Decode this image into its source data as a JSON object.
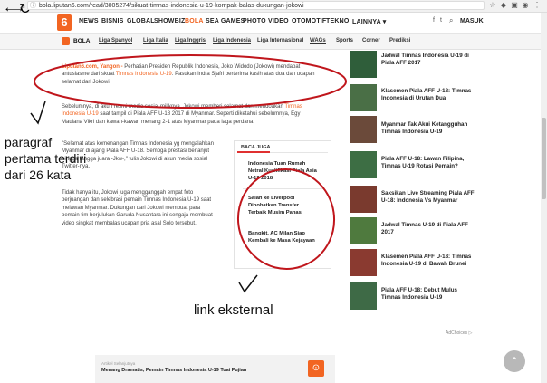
{
  "browser": {
    "url": "bola.liputan6.com/read/3005274/sikuat-timnas-indonesia-u-19-kompak-balas-dukungan-jokowi"
  },
  "header": {
    "logo_text": "6",
    "nav": [
      "NEWS",
      "BISNIS",
      "GLOBAL",
      "SHOWBIZ",
      "BOLA",
      "SEA GAMES",
      "PHOTO",
      "VIDEO",
      "OTOMOTIF",
      "TEKNO",
      "LAINNYA ▾"
    ],
    "active": "BOLA",
    "login": "MASUK"
  },
  "subnav": {
    "section": "BOLA",
    "items": [
      "Liga Spanyol",
      "Liga Italia",
      "Liga Inggris",
      "Liga Indonesia",
      "Liga Internasional",
      "WAGs",
      "Sports",
      "Corner",
      "Prediksi"
    ]
  },
  "article": {
    "p1_source": "Liputan6.com, Yangon -",
    "p1_a": " Perhatian Presiden Republik Indonesia, Joko Widodo (Jokowi) mendapat",
    "p1_b": "antusiasme dari skuat ",
    "p1_link": "Timnas Indonesia U-19",
    "p1_c": ". Pasukan Indra Sjafri berterima kasih atas doa dan ucapan",
    "p1_d": "selamat dari Jokowi.",
    "p2_a": "Sebelumnya, di akun resmi media sosial miliknya, Jokowi memberi selamat dan mendoakan ",
    "p2_link1": "Timnas",
    "p2_b": "Indonesia U-19",
    "p2_c": " saat tampil di Piala AFF U-18 2017 di Myanmar. Seperti diketahui sebelumnya, Egy",
    "p2_d": "Maulana Vikri dan kawan-kawan menang 2-1 atas Myanmar pada laga perdana.",
    "p3_lines": [
      "\"Selamat atas kemenangan Timnas Indonesia yg mengalahkan",
      "Myanmar di ajang Piala AFF U-18. Semoga prestasi berlanjut",
      "hingga tangga juara -Jkw-,\" tulis Jokowi di akun media sosial",
      "Twitter-nya."
    ],
    "p4_lines": [
      "Tidak hanya itu, Jokowi juga mengganggah empat foto",
      "perjuangan dan selebrasi pemain Timnas Indonesia U-19 saat",
      "melawan Myanmar. Dukungan dari Jokowi membuat para",
      "pemain tim berjulukan Garuda Nusantara ini sengaja membuat",
      "video singkat membalas ucapan pria asal Solo tersebut."
    ]
  },
  "baca_juga": {
    "title": "BACA JUGA",
    "items": [
      [
        "Indonesia Tuan Rumah",
        "Netral Kualifikasi Piala Asia",
        "U-19 2018"
      ],
      [
        "Salah ke Liverpool",
        "Dinobatkan Transfer",
        "Terbaik Musim Panas"
      ],
      [
        "Bangkit, AC Milan Siap",
        "Kembali ke Masa Kejayaan"
      ]
    ]
  },
  "sidebar": {
    "items": [
      [
        "Jadwal Timnas Indonesia U-19 di",
        "Piala AFF 2017"
      ],
      [
        "Klasemen Piala AFF U-18: Timnas",
        "Indonesia di Urutan Dua"
      ],
      [
        "Myanmar Tak Akui Ketangguhan",
        "Timnas Indonesia U-19"
      ],
      [
        "Piala AFF U-18: Lawan Filipina,",
        "Timnas U-19 Rotasi Pemain?"
      ],
      [
        "Saksikan Live Streaming Piala AFF",
        "U-18: Indonesia Vs Myanmar"
      ],
      [
        "Jadwal Timnas U-19 di Piala AFF",
        "2017"
      ],
      [
        "Klasemen Piala AFF U-18: Timnas",
        "Indonesia U-19 di Bawah Brunei"
      ],
      [
        "Piala AFF U-18: Debut Mulus",
        "Timnas Indonesia U-19"
      ]
    ],
    "adchoices": "AdChoices ▷"
  },
  "bottom_ad": {
    "label": "Artikel Selanjutnya",
    "text": "Menang Dramatis, Pemain Timnas Indonesia U-19 Tuai Pujian"
  },
  "annotations": {
    "paragraph_note": "paragraf pertama terdiri dari 26 kata",
    "link_note": "link eksternal"
  }
}
